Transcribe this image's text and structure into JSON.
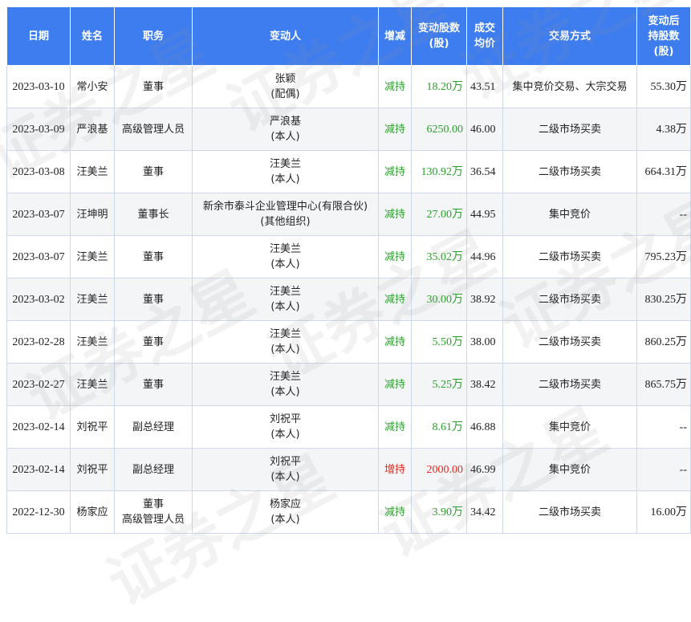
{
  "headers": [
    "日期",
    "姓名",
    "职务",
    "变动人",
    "增减",
    "变动股数\n(股)",
    "成交\n均价",
    "交易方式",
    "变动后\n持股数\n(股)"
  ],
  "rows": [
    {
      "date": "2023-03-10",
      "name": "常小安",
      "position": "董事",
      "changer": "张颖\n(配偶)",
      "direction": "减持",
      "direction_type": "dec",
      "shares": "18.20万",
      "price": "43.51",
      "method": "集中竞价交易、大宗交易",
      "holding": "55.30万"
    },
    {
      "date": "2023-03-09",
      "name": "严浪基",
      "position": "高级管理人员",
      "changer": "严浪基\n(本人)",
      "direction": "减持",
      "direction_type": "dec",
      "shares": "6250.00",
      "price": "46.00",
      "method": "二级市场买卖",
      "holding": "4.38万"
    },
    {
      "date": "2023-03-08",
      "name": "汪美兰",
      "position": "董事",
      "changer": "汪美兰\n(本人)",
      "direction": "减持",
      "direction_type": "dec",
      "shares": "130.92万",
      "price": "36.54",
      "method": "二级市场买卖",
      "holding": "664.31万"
    },
    {
      "date": "2023-03-07",
      "name": "汪坤明",
      "position": "董事长",
      "changer": "新余市泰斗企业管理中心(有限合伙)\n(其他组织)",
      "direction": "减持",
      "direction_type": "dec",
      "shares": "27.00万",
      "price": "44.95",
      "method": "集中竞价",
      "holding": "--"
    },
    {
      "date": "2023-03-07",
      "name": "汪美兰",
      "position": "董事",
      "changer": "汪美兰\n(本人)",
      "direction": "减持",
      "direction_type": "dec",
      "shares": "35.02万",
      "price": "44.96",
      "method": "二级市场买卖",
      "holding": "795.23万"
    },
    {
      "date": "2023-03-02",
      "name": "汪美兰",
      "position": "董事",
      "changer": "汪美兰\n(本人)",
      "direction": "减持",
      "direction_type": "dec",
      "shares": "30.00万",
      "price": "38.92",
      "method": "二级市场买卖",
      "holding": "830.25万"
    },
    {
      "date": "2023-02-28",
      "name": "汪美兰",
      "position": "董事",
      "changer": "汪美兰\n(本人)",
      "direction": "减持",
      "direction_type": "dec",
      "shares": "5.50万",
      "price": "38.00",
      "method": "二级市场买卖",
      "holding": "860.25万"
    },
    {
      "date": "2023-02-27",
      "name": "汪美兰",
      "position": "董事",
      "changer": "汪美兰\n(本人)",
      "direction": "减持",
      "direction_type": "dec",
      "shares": "5.25万",
      "price": "38.42",
      "method": "二级市场买卖",
      "holding": "865.75万"
    },
    {
      "date": "2023-02-14",
      "name": "刘祝平",
      "position": "副总经理",
      "changer": "刘祝平\n(本人)",
      "direction": "减持",
      "direction_type": "dec",
      "shares": "8.61万",
      "price": "46.88",
      "method": "集中竞价",
      "holding": "--"
    },
    {
      "date": "2023-02-14",
      "name": "刘祝平",
      "position": "副总经理",
      "changer": "刘祝平\n(本人)",
      "direction": "增持",
      "direction_type": "inc",
      "shares": "2000.00",
      "price": "46.99",
      "method": "集中竞价",
      "holding": "--"
    },
    {
      "date": "2022-12-30",
      "name": "杨家应",
      "position": "董事\n高级管理人员",
      "changer": "杨家应\n(本人)",
      "direction": "减持",
      "direction_type": "dec",
      "shares": "3.90万",
      "price": "34.42",
      "method": "二级市场买卖",
      "holding": "16.00万"
    }
  ],
  "colors": {
    "header_bg": "#3d7df0",
    "decrease": "#2ca02c",
    "increase": "#e0281e",
    "row_alt": "#f4f5f7"
  },
  "watermark": "证券之星"
}
